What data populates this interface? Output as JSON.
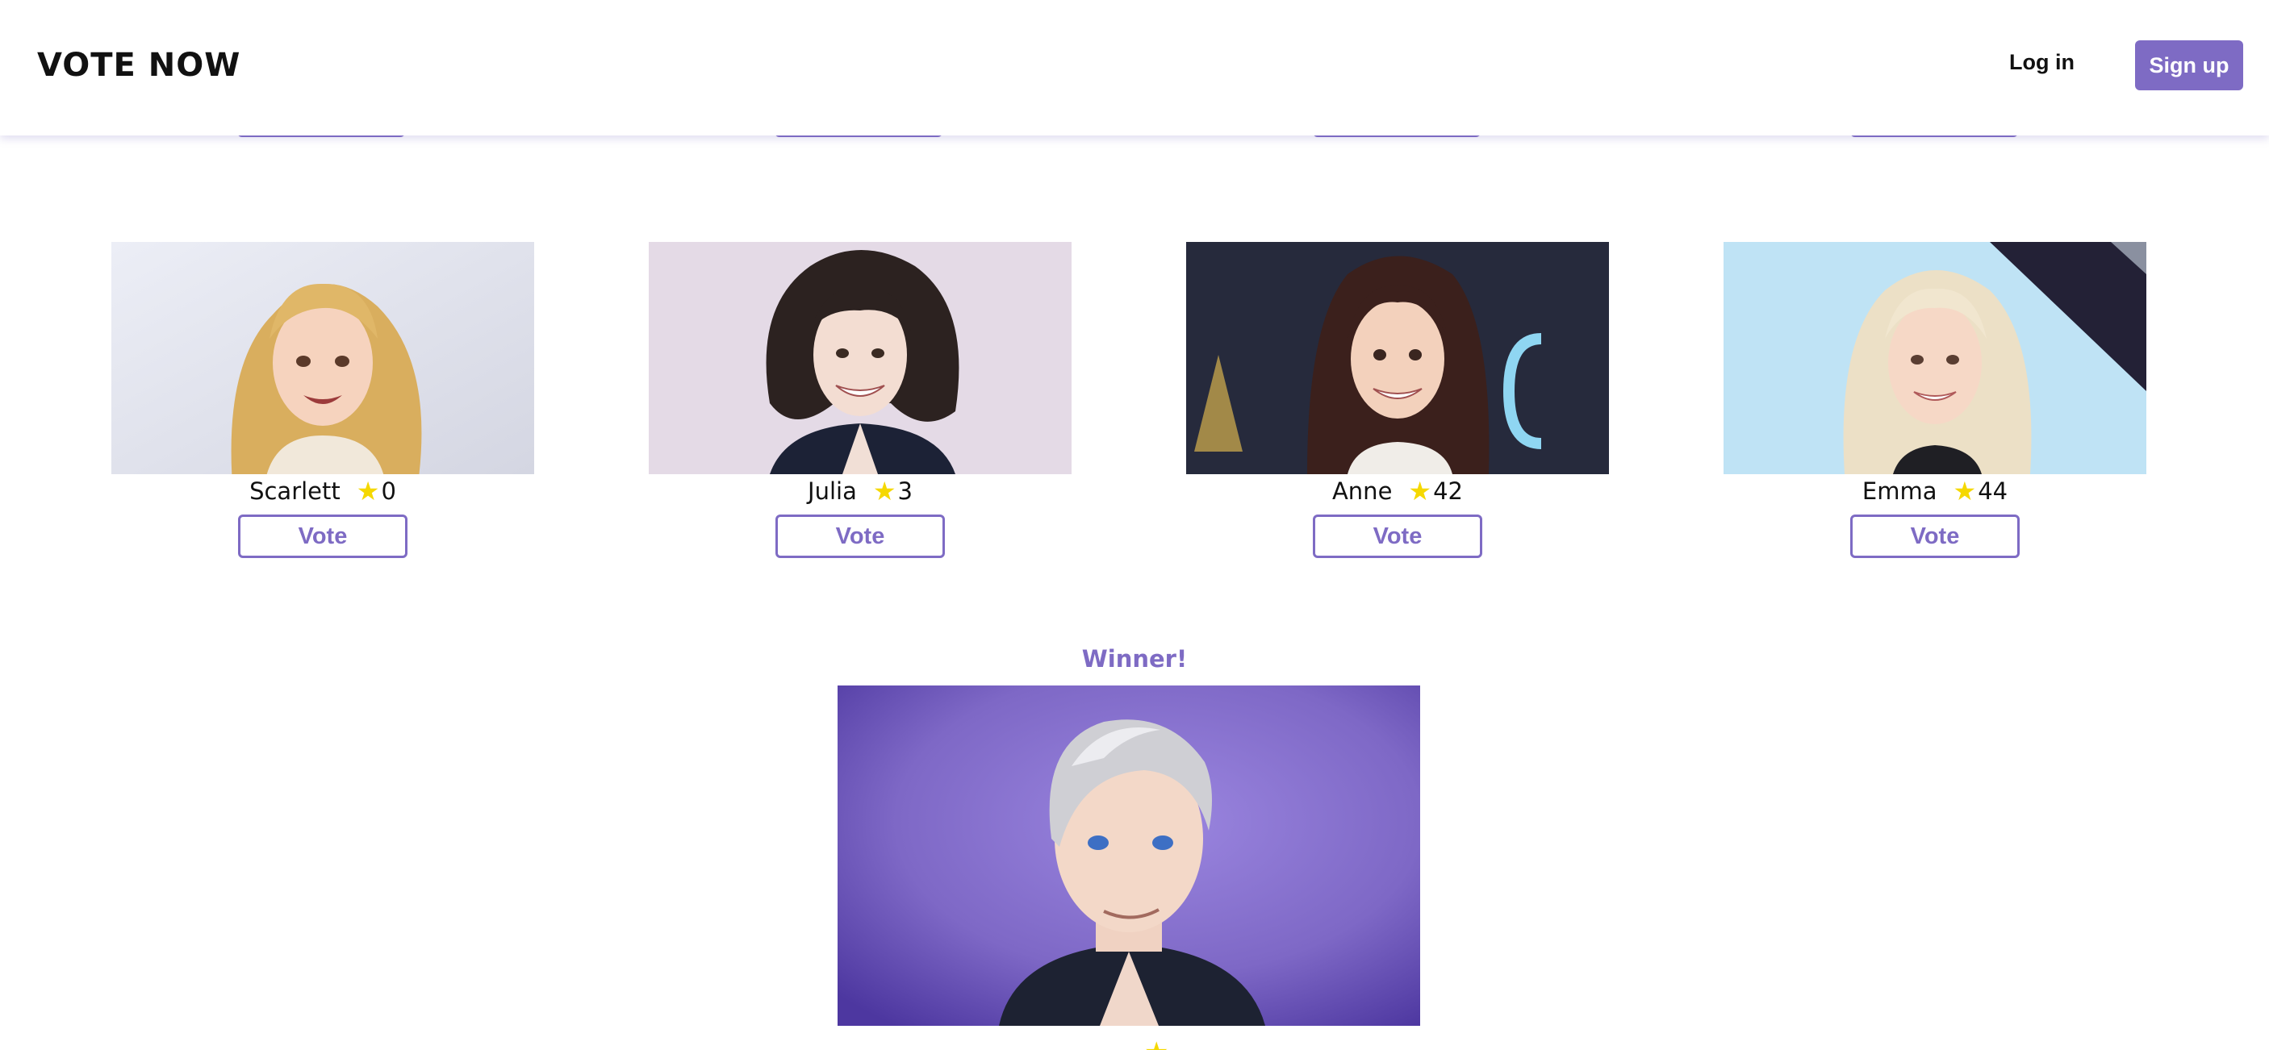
{
  "header": {
    "brand": "VOTE NOW",
    "login_label": "Log in",
    "signup_label": "Sign up"
  },
  "candidates": [
    {
      "name": "Scarlett",
      "votes": "0",
      "vote_label": "Vote"
    },
    {
      "name": "Julia",
      "votes": "3",
      "vote_label": "Vote"
    },
    {
      "name": "Anne",
      "votes": "42",
      "vote_label": "Vote"
    },
    {
      "name": "Emma",
      "votes": "44",
      "vote_label": "Vote"
    }
  ],
  "winner": {
    "label": "Winner!"
  },
  "icons": {
    "star": "star-icon"
  },
  "colors": {
    "accent": "#7e6bc4",
    "star": "#f5d800"
  }
}
